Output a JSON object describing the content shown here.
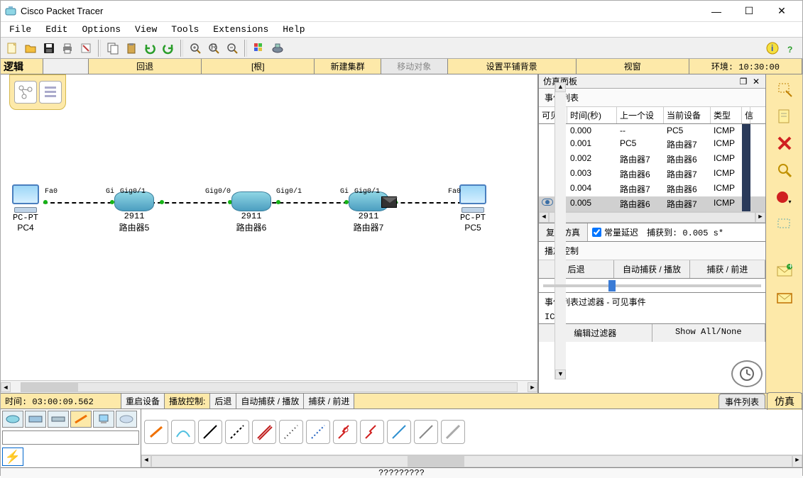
{
  "window": {
    "title": "Cisco Packet Tracer"
  },
  "menu": {
    "file": "File",
    "edit": "Edit",
    "options": "Options",
    "view": "View",
    "tools": "Tools",
    "extensions": "Extensions",
    "help": "Help"
  },
  "secbar": {
    "logical": "逻辑",
    "back": "回退",
    "root": "[根]",
    "new_cluster": "新建集群",
    "move_object": "移动对象",
    "set_tile_bg": "设置平铺背景",
    "viewport": "视窗",
    "env": "环境: 10:30:00"
  },
  "topology": {
    "pc4": {
      "type": "PC-PT",
      "name": "PC4",
      "port": "Fa0"
    },
    "router5": {
      "type": "2911",
      "name": "路由器5",
      "port_left": "Gi",
      "port_right": "Gig0/1"
    },
    "router6": {
      "type": "2911",
      "name": "路由器6",
      "port_left": "Gig0/0",
      "port_right": "Gig0/1"
    },
    "router7": {
      "type": "2911",
      "name": "路由器7",
      "port_left": "Gi",
      "port_right": "Gig0/1"
    },
    "pc5": {
      "type": "PC-PT",
      "name": "PC5",
      "port": "Fa0"
    }
  },
  "sim_panel": {
    "title": "仿真面板",
    "event_list": "事件列表",
    "headers": {
      "vis": "可见.",
      "time": "时间(秒)",
      "last": "上一个设",
      "at": "当前设备",
      "type": "类型",
      "info": "信"
    },
    "rows": [
      {
        "vis": "",
        "time": "0.000",
        "last": "--",
        "at": "PC5",
        "type": "ICMP"
      },
      {
        "vis": "",
        "time": "0.001",
        "last": "PC5",
        "at": "路由器7",
        "type": "ICMP"
      },
      {
        "vis": "",
        "time": "0.002",
        "last": "路由器7",
        "at": "路由器6",
        "type": "ICMP"
      },
      {
        "vis": "",
        "time": "0.003",
        "last": "路由器6",
        "at": "路由器7",
        "type": "ICMP"
      },
      {
        "vis": "",
        "time": "0.004",
        "last": "路由器7",
        "at": "路由器6",
        "type": "ICMP"
      },
      {
        "vis": "eye",
        "time": "0.005",
        "last": "路由器6",
        "at": "路由器7",
        "type": "ICMP"
      }
    ],
    "reset": "复位仿真",
    "const_delay": "常量延迟",
    "captured": "捕获到: 0.005 s*",
    "play_control": "播放控制",
    "back": "后退",
    "auto_play": "自动捕获 / 播放",
    "capture_fwd": "捕获 / 前进",
    "filter_title": "事件列表过滤器 - 可见事件",
    "filter_proto": "ICMP",
    "edit_filters": "编辑过滤器",
    "show_all": "Show All/None"
  },
  "status": {
    "time": "时间: 03:00:09.562",
    "restart": "重启设备",
    "play_label": "播放控制:",
    "back": "后退",
    "auto": "自动捕获 / 播放",
    "cap": "捕获 / 前进",
    "event_list": "事件列表",
    "simulation": "仿真"
  },
  "bottom": {
    "footer": "?????????"
  }
}
